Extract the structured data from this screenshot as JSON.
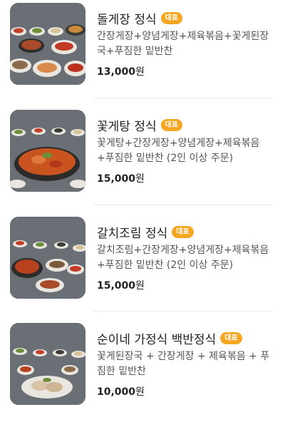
{
  "menu_items": [
    {
      "name": "돌게장 정식",
      "badge": "대표",
      "description": "간장게장+양념게장+제육볶음+꽃게된장국+푸짐한 밑반찬",
      "price_number": "13,000",
      "price_unit": "원"
    },
    {
      "name": "꽃게탕 정식",
      "badge": "대표",
      "description": "꽃게탕+간장게장+양념게장+제육볶음+푸짐한 밑반찬 (2인 이상 주문)",
      "price_number": "15,000",
      "price_unit": "원"
    },
    {
      "name": "갈치조림 정식",
      "badge": "대표",
      "description": "갈치조림+간장게장+양념게장+제육볶음+푸짐한 밑반찬 (2인 이상 주문)",
      "price_number": "15,000",
      "price_unit": "원"
    },
    {
      "name": "순이네 가정식 백반정식",
      "badge": "대표",
      "description": "꽃게된장국 + 간장게장 + 제육볶음 + 푸짐한 밑반찬",
      "price_number": "10,000",
      "price_unit": "원"
    }
  ]
}
